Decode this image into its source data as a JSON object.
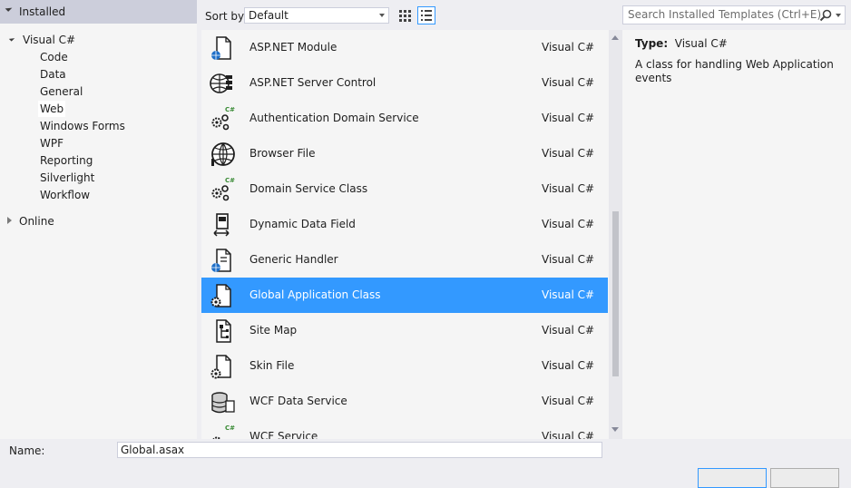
{
  "tree": {
    "installed": "Installed",
    "visual_csharp": "Visual C#",
    "children": [
      "Code",
      "Data",
      "General",
      "Web",
      "Windows Forms",
      "WPF",
      "Reporting",
      "Silverlight",
      "Workflow"
    ],
    "selected": "Web",
    "online": "Online"
  },
  "toolbar": {
    "sort_label": "Sort by:",
    "sort_value": "Default",
    "search_placeholder": "Search Installed Templates (Ctrl+E)"
  },
  "templates": [
    {
      "name": "ASP.NET Module",
      "lang": "Visual C#",
      "icon": "module-icon"
    },
    {
      "name": "ASP.NET Server Control",
      "lang": "Visual C#",
      "icon": "server-control-icon"
    },
    {
      "name": "Authentication Domain Service",
      "lang": "Visual C#",
      "icon": "domain-service-icon"
    },
    {
      "name": "Browser File",
      "lang": "Visual C#",
      "icon": "globe-icon"
    },
    {
      "name": "Domain Service Class",
      "lang": "Visual C#",
      "icon": "domain-service-icon"
    },
    {
      "name": "Dynamic Data Field",
      "lang": "Visual C#",
      "icon": "data-field-icon"
    },
    {
      "name": "Generic Handler",
      "lang": "Visual C#",
      "icon": "handler-icon"
    },
    {
      "name": "Global Application Class",
      "lang": "Visual C#",
      "icon": "gear-file-icon"
    },
    {
      "name": "Site Map",
      "lang": "Visual C#",
      "icon": "sitemap-icon"
    },
    {
      "name": "Skin File",
      "lang": "Visual C#",
      "icon": "skin-file-icon"
    },
    {
      "name": "WCF Data Service",
      "lang": "Visual C#",
      "icon": "database-icon"
    },
    {
      "name": "WCF Service",
      "lang": "Visual C#",
      "icon": "wcf-service-icon"
    }
  ],
  "selected_template": "Global Application Class",
  "detail": {
    "type_label": "Type:",
    "type_value": "Visual C#",
    "description": "A class for handling Web Application events"
  },
  "bottom": {
    "name_label": "Name:",
    "name_value": "Global.asax"
  },
  "colors": {
    "selection": "#3399ff",
    "installed_header": "#cccedb",
    "panel": "#f5f5f5"
  }
}
